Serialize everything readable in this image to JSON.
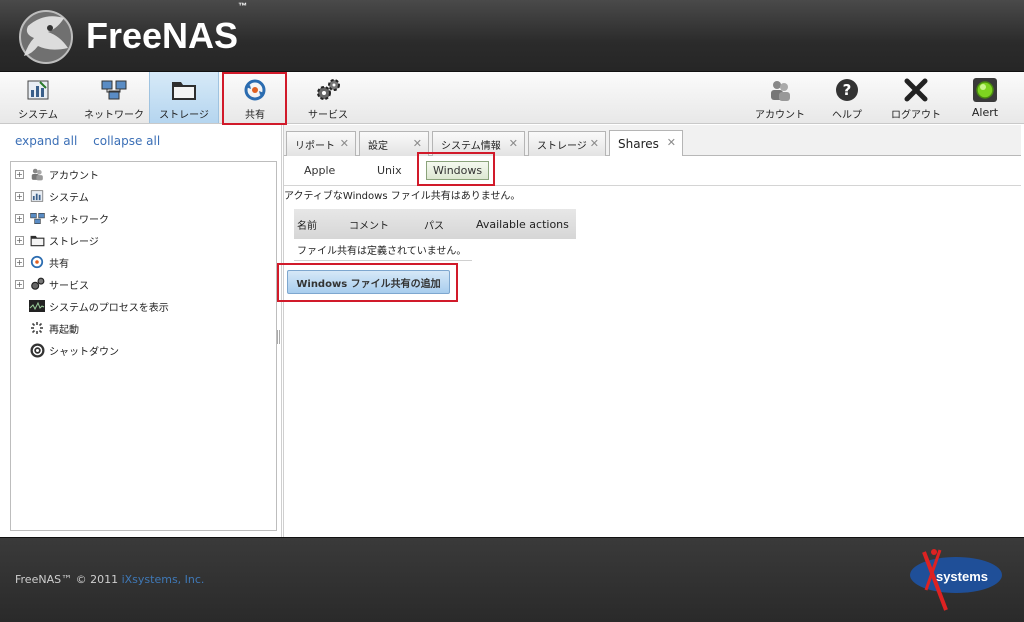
{
  "header": {
    "app_name": "FreeNAS",
    "trademark": "™"
  },
  "toolbar": {
    "items": [
      {
        "label": "システム",
        "icon": "system-icon"
      },
      {
        "label": "ネットワーク",
        "icon": "network-icon"
      },
      {
        "label": "ストレージ",
        "icon": "storage-icon"
      },
      {
        "label": "共有",
        "icon": "sharing-icon"
      },
      {
        "label": "サービス",
        "icon": "services-icon"
      }
    ],
    "right_items": [
      {
        "label": "アカウント",
        "icon": "account-icon"
      },
      {
        "label": "ヘルプ",
        "icon": "help-icon"
      },
      {
        "label": "ログアウト",
        "icon": "logout-icon"
      },
      {
        "label": "Alert",
        "icon": "alert-icon"
      }
    ]
  },
  "left": {
    "expand_all": "expand all",
    "collapse_all": "collapse all",
    "tree": [
      {
        "label": "アカウント",
        "icon": "account-icon"
      },
      {
        "label": "システム",
        "icon": "system-icon"
      },
      {
        "label": "ネットワーク",
        "icon": "network-icon"
      },
      {
        "label": "ストレージ",
        "icon": "storage-icon"
      },
      {
        "label": "共有",
        "icon": "sharing-icon"
      },
      {
        "label": "サービス",
        "icon": "services-icon"
      },
      {
        "label": "システムのプロセスを表示",
        "icon": "process-icon"
      },
      {
        "label": "再起動",
        "icon": "reboot-icon"
      },
      {
        "label": "シャットダウン",
        "icon": "shutdown-icon"
      }
    ]
  },
  "tabs": [
    {
      "label": "リポート"
    },
    {
      "label": "設定"
    },
    {
      "label": "システム情報"
    },
    {
      "label": "ストレージ"
    },
    {
      "label": "Shares"
    }
  ],
  "subtabs": [
    "Apple",
    "Unix",
    "Windows"
  ],
  "content": {
    "message": "アクティブなWindows ファイル共有はありません。",
    "columns": [
      "名前",
      "コメント",
      "パス",
      "Available actions"
    ],
    "empty_text": "ファイル共有は定義されていません。",
    "add_button": "Windows ファイル共有の追加"
  },
  "footer": {
    "copyright": "FreeNAS™ © 2011",
    "company": "iXsystems, Inc.",
    "logo_text": "systems"
  },
  "colors": {
    "accent_red": "#d11a2a",
    "link_blue": "#3b6fb6",
    "active_blue": "#b5d5ef"
  }
}
